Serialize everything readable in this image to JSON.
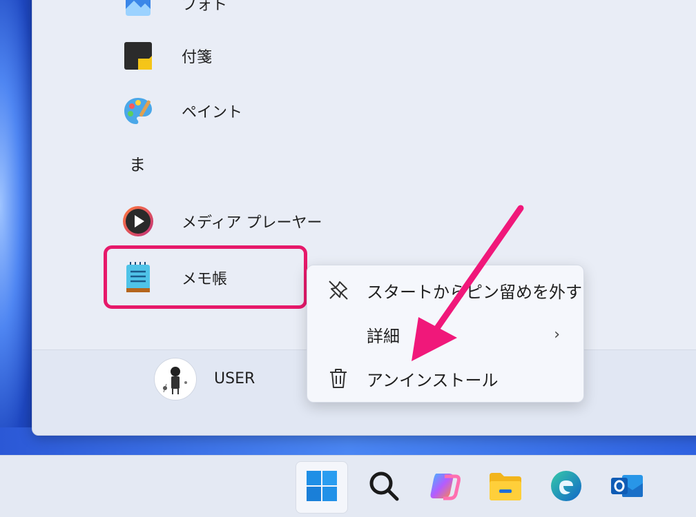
{
  "start_menu": {
    "apps": [
      {
        "label": "フォト",
        "icon": "photos-icon"
      },
      {
        "label": "付箋",
        "icon": "sticky-notes-icon"
      },
      {
        "label": "ペイント",
        "icon": "paint-icon"
      },
      {
        "label": "メディア プレーヤー",
        "icon": "media-player-icon"
      },
      {
        "label": "メモ帳",
        "icon": "notepad-icon"
      }
    ],
    "section_letter": "ま",
    "user": {
      "name": "USER"
    }
  },
  "context_menu": {
    "items": [
      {
        "label": "スタートからピン留めを外す",
        "icon": "unpin-icon"
      },
      {
        "label": "詳細",
        "chevron": "›"
      },
      {
        "label": "アンインストール",
        "icon": "trash-icon"
      }
    ]
  },
  "taskbar": {
    "items": [
      "start-icon",
      "search-icon",
      "copilot-icon",
      "file-explorer-icon",
      "edge-icon",
      "outlook-icon"
    ]
  },
  "colors": {
    "highlight": "#e6196a",
    "arrow": "#f0187a",
    "panel_bg": "#e9edf6",
    "menu_bg": "#f5f7fc"
  }
}
